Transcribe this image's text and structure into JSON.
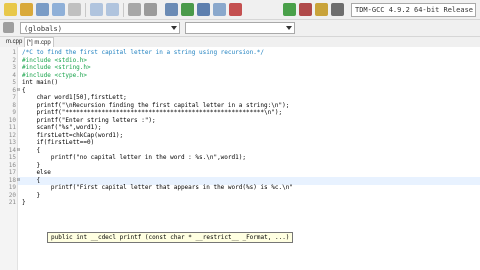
{
  "toolbar": {
    "scope_combo": "(globals)",
    "compiler_combo": "TDM-GCC 4.9.2 64-bit Release"
  },
  "tabs": [
    {
      "label": "m.cpp"
    },
    {
      "label": "[*] m.cpp"
    }
  ],
  "editor": {
    "line_numbers": [
      "1",
      "2",
      "3",
      "4",
      "5",
      "6",
      "7",
      "8",
      "9",
      "10",
      "11",
      "12",
      "13",
      "14",
      "15",
      "16",
      "17",
      "18",
      "19",
      "20",
      "21"
    ],
    "lines": [
      "/*C to find the first capital letter in a string using recursion.*/",
      "#include <stdio.h>",
      "#include <string.h>",
      "#include <ctype.h>",
      "int main()",
      "{",
      "    char word1[50],firstLett;",
      "    printf(\"\\nRecursion finding the first capital letter in a string:\\n\");",
      "    printf(\"*******************************************************\\n\");",
      "    printf(\"Enter string letters :\");",
      "    scanf(\"%s\",word1);",
      "    firstLett=chkCap(word1);",
      "    if(firstLett==0)",
      "    {",
      "        printf(\"no capital letter in the word : %s.\\n\",word1);",
      "    }",
      "    else",
      "    {",
      "        printf(\"First capital letter that appears in the word(%s) is %c.\\n\"",
      "    }",
      "}"
    ],
    "tooltip": "public int __cdecl printf (const char * __restrict__ _Format, ...)"
  }
}
